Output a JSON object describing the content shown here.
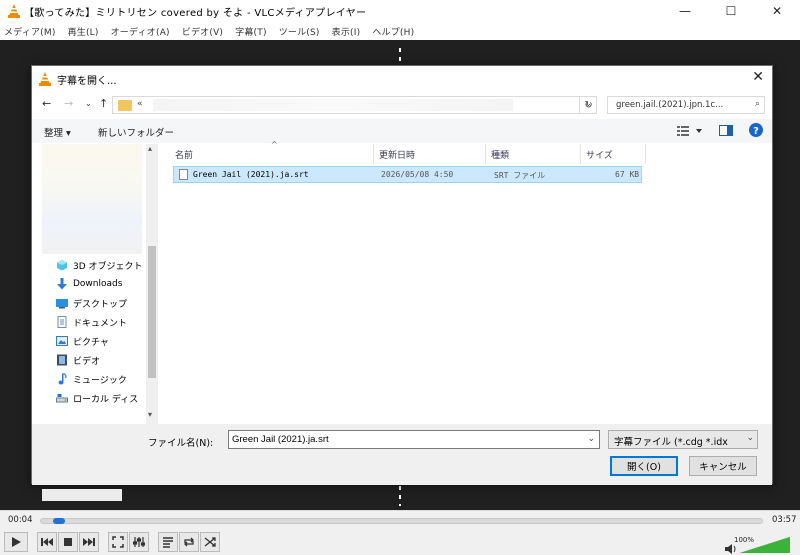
{
  "app": {
    "window_title": "【歌ってみた】ミリトリセン covered by そよ - VLCメディアプレイヤー",
    "window_buttons": [
      "—",
      "☐",
      "✕"
    ]
  },
  "menu": [
    "メディア(M)",
    "再生(L)",
    "オーディオ(A)",
    "ビデオ(V)",
    "字幕(T)",
    "ツール(S)",
    "表示(I)",
    "ヘルプ(H)"
  ],
  "player": {
    "elapsed": "00:04",
    "total": "03:57",
    "progress": 0.017,
    "volume_label": "100%",
    "volume": 1.0
  },
  "dialog": {
    "title": "字幕を開く...",
    "close": "✕",
    "address_prefix": "«",
    "search_placeholder": "green.jail.(2021).jpn.1c...",
    "toolbar": {
      "organize": "整理 ▾",
      "new_folder": "新しいフォルダー"
    },
    "nav_items": [
      {
        "label": "3D オブジェクト",
        "icon": "3d-objects-icon"
      },
      {
        "label": "Downloads",
        "icon": "downloads-icon"
      },
      {
        "label": "デスクトップ",
        "icon": "desktop-icon"
      },
      {
        "label": "ドキュメント",
        "icon": "documents-icon"
      },
      {
        "label": "ピクチャ",
        "icon": "pictures-icon"
      },
      {
        "label": "ビデオ",
        "icon": "videos-icon"
      },
      {
        "label": "ミュージック",
        "icon": "music-icon"
      },
      {
        "label": "ローカル ディス",
        "icon": "local-disk-icon"
      }
    ],
    "columns": [
      "名前",
      "更新日時",
      "種類",
      "サイズ"
    ],
    "files": [
      {
        "name": "Green Jail (2021).ja.srt",
        "modified": "2026/05/08 4:50",
        "type": "SRT ファイル",
        "size": "67 KB"
      }
    ],
    "filename_label": "ファイル名(N):",
    "filename_value": "Green Jail (2021).ja.srt",
    "filetype_value": "字幕ファイル (*.cdg *.idx",
    "open_button": "開く(O)",
    "cancel_button": "キャンセル"
  }
}
